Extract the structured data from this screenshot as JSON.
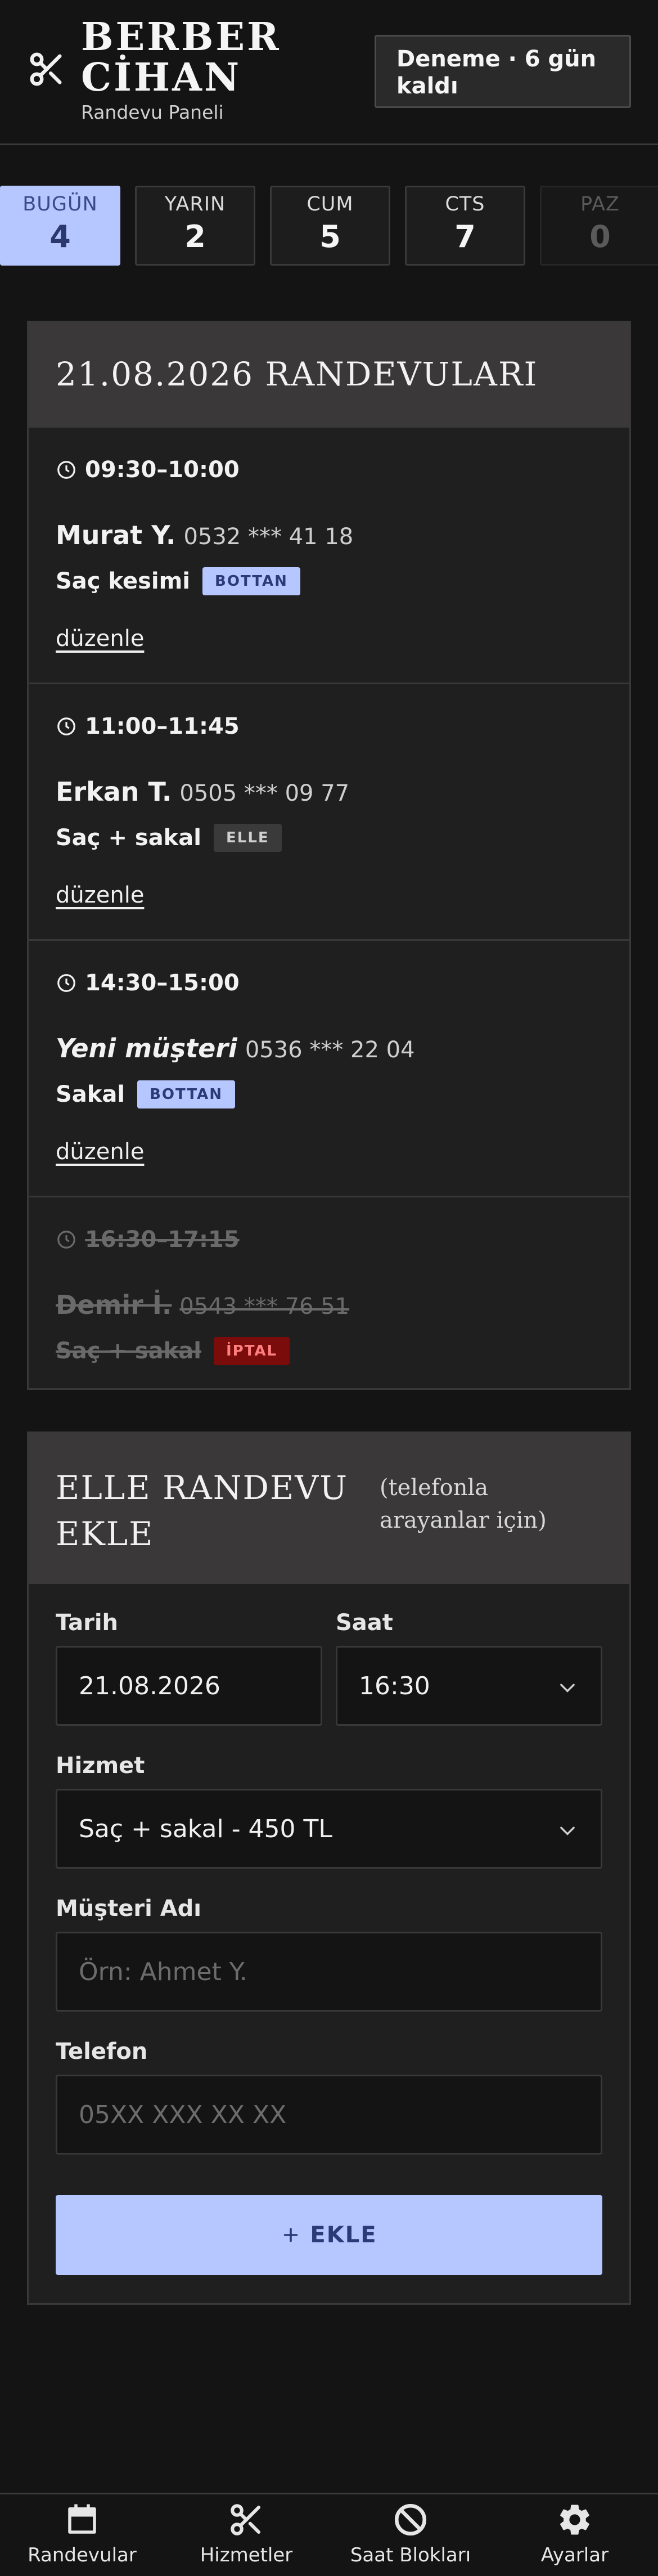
{
  "header": {
    "brand_line1": "BERBER",
    "brand_line2": "CİHAN",
    "subtitle": "Randevu Paneli",
    "trial": "Deneme · 6 gün kaldı"
  },
  "days": [
    {
      "name": "BUGÜN",
      "date": "4",
      "active": true
    },
    {
      "name": "YARIN",
      "date": "2"
    },
    {
      "name": "CUM",
      "date": "5"
    },
    {
      "name": "CTS",
      "date": "7"
    },
    {
      "name": "PAZ",
      "date": "0",
      "faded": true
    }
  ],
  "appointments": {
    "title": "21.08.2026 RANDEVULARI",
    "edit_label": "düzenle",
    "items": [
      {
        "time": "09:30–10:00",
        "name": "Murat Y.",
        "phone": "0532 *** 41 18",
        "service": "Saç kesimi",
        "badge": "BOTTAN"
      },
      {
        "time": "11:00–11:45",
        "name": "Erkan T.",
        "phone": "0505 *** 09 77",
        "service": "Saç + sakal",
        "badge": "ELLE"
      },
      {
        "time": "14:30–15:00",
        "name": "Yeni müşteri",
        "phone": "0536 *** 22 04",
        "service": "Sakal",
        "badge": "BOTTAN"
      },
      {
        "time": "16:30–17:15",
        "name": "Demir İ.",
        "phone": "0543 *** 76 51",
        "service": "Saç + sakal",
        "badge": "İPTAL"
      }
    ]
  },
  "add_form": {
    "title": "ELLE RANDEVU EKLE",
    "note": "(telefonla arayanlar için)",
    "date_label": "Tarih",
    "date_value": "21.08.2026",
    "time_label": "Saat",
    "time_value": "16:30",
    "service_label": "Hizmet",
    "service_value": "Saç + sakal - 450 TL",
    "name_label": "Müşteri Adı",
    "name_placeholder": "Örn: Ahmet Y.",
    "phone_label": "Telefon",
    "phone_placeholder": "05XX XXX XX XX",
    "submit_label": "EKLE"
  },
  "nav": [
    {
      "label": "Randevular",
      "icon": "calendar-icon"
    },
    {
      "label": "Hizmetler",
      "icon": "scissors-icon"
    },
    {
      "label": "Saat Blokları",
      "icon": "block-icon"
    },
    {
      "label": "Ayarlar",
      "icon": "gear-icon"
    }
  ],
  "colors": {
    "accent": "#b6c6ff",
    "background": "#141414",
    "card": "#1f1f1f",
    "cancel": "#7a0c0c"
  }
}
